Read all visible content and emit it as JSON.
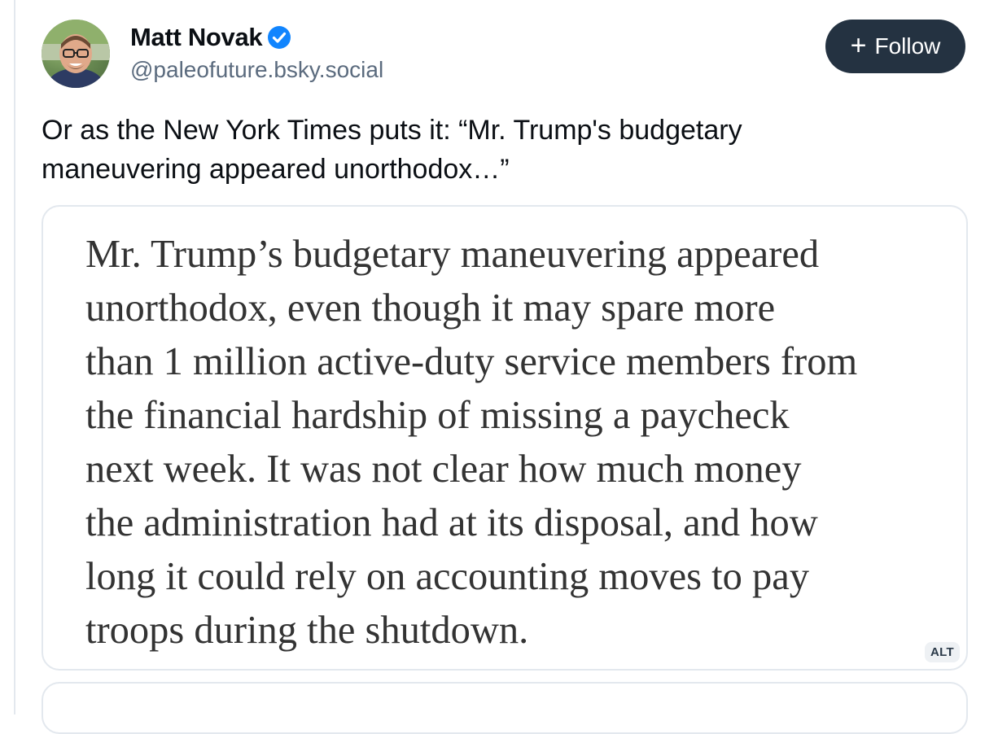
{
  "post": {
    "author": {
      "display_name": "Matt Novak",
      "handle": "@paleofuture.bsky.social",
      "verified": true
    },
    "follow_button": {
      "icon": "plus-icon",
      "label": "Follow"
    },
    "text_lines": [
      "Or as the New York Times puts it: “Mr. Trump's budgetary",
      "maneuvering appeared unorthodox…”"
    ],
    "image": {
      "quote_lines": [
        "Mr. Trump’s budgetary maneuvering appeared",
        "unorthodox, even though it may spare more",
        "than 1 million active-duty service members from",
        "the financial hardship of missing a paycheck",
        "next week. It was not clear how much money",
        "the administration had at its disposal, and how",
        "long it could rely on accounting moves to pay",
        "troops during the shutdown."
      ],
      "alt_badge": "ALT"
    }
  },
  "colors": {
    "follow_bg": "#243241",
    "verified": "#1185fe",
    "handle": "#5b6b7e",
    "border": "#e3e8ee"
  }
}
